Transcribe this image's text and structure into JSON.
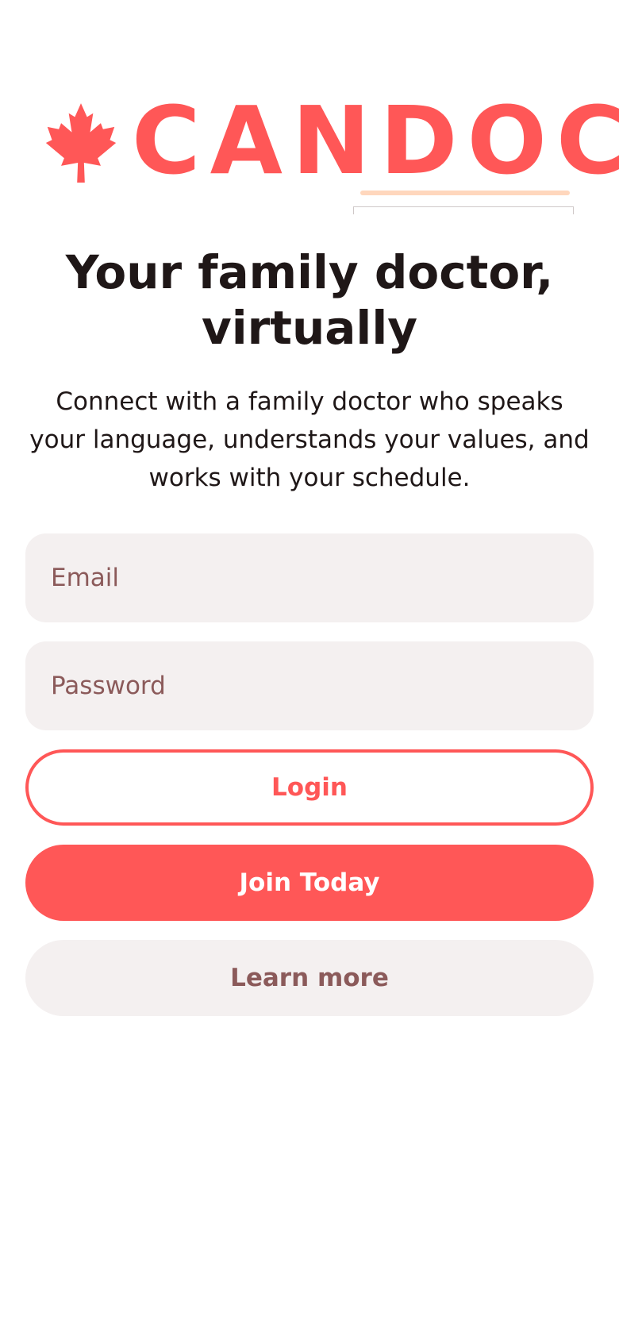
{
  "brand": {
    "name": "CANDOC",
    "logo_icon": "maple-leaf-icon",
    "primary_color": "#ff5757",
    "underline_color": "#ffd7bd"
  },
  "hero": {
    "title": "Your family doctor, virtually",
    "subtitle": "Connect with a family doctor who speaks your language, understands your values, and works with your schedule."
  },
  "form": {
    "email_placeholder": "Email",
    "password_placeholder": "Password"
  },
  "actions": {
    "login_label": "Login",
    "join_label": "Join Today",
    "learn_label": "Learn more"
  },
  "colors": {
    "input_bg": "#f4f0f0",
    "muted_text": "#8b5a5a",
    "heading_text": "#1f1717"
  }
}
